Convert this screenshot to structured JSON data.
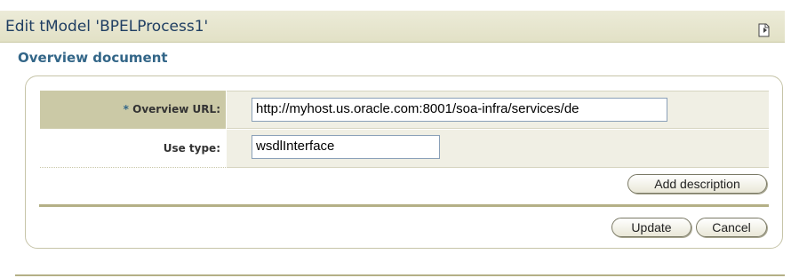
{
  "header": {
    "title": "Edit tModel 'BPELProcess1'"
  },
  "section": {
    "title": "Overview document"
  },
  "form": {
    "overview_url": {
      "required_marker": "*",
      "label": "Overview URL:",
      "value": "http://myhost.us.oracle.com:8001/soa-infra/services/de"
    },
    "use_type": {
      "label": "Use type:",
      "value": "wsdlInterface"
    }
  },
  "buttons": {
    "add_description": "Add description",
    "update": "Update",
    "cancel": "Cancel"
  },
  "colors": {
    "title_text": "#1f3e62",
    "section_title": "#336688",
    "label_highlight": "#cbc9a6",
    "field_band": "#f0efe4",
    "separator": "#b4b086"
  }
}
